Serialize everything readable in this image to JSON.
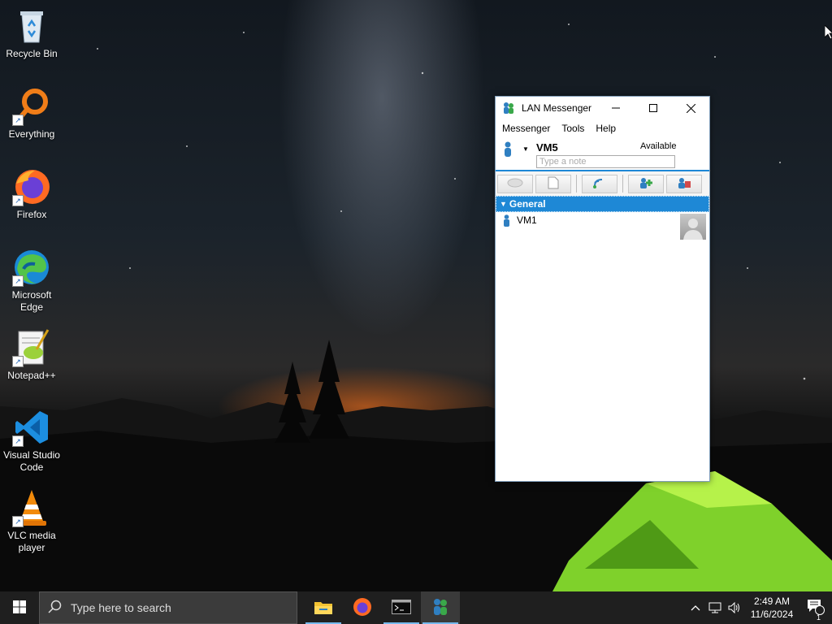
{
  "desktop": {
    "icons": [
      {
        "label": "Recycle Bin",
        "icon": "recycle-bin-icon"
      },
      {
        "label": "Everything",
        "icon": "everything-search-icon"
      },
      {
        "label": "Firefox",
        "icon": "firefox-icon"
      },
      {
        "label": "Microsoft Edge",
        "icon": "edge-icon"
      },
      {
        "label": "Notepad++",
        "icon": "notepadpp-icon"
      },
      {
        "label": "Visual Studio Code",
        "icon": "vscode-icon"
      },
      {
        "label": "VLC media player",
        "icon": "vlc-icon"
      }
    ]
  },
  "window": {
    "title": "LAN Messenger",
    "menu": [
      "Messenger",
      "Tools",
      "Help"
    ],
    "user": {
      "name": "VM5",
      "status": "Available",
      "note_placeholder": "Type a note"
    },
    "group": {
      "name": "General"
    },
    "contacts": [
      {
        "name": "VM1"
      }
    ]
  },
  "taskbar": {
    "search_placeholder": "Type here to search",
    "apps": [
      "file-explorer-icon",
      "firefox-icon",
      "terminal-icon",
      "lan-messenger-icon"
    ],
    "clock": {
      "time": "2:49 AM",
      "date": "11/6/2024"
    },
    "notification_count": "1"
  },
  "colors": {
    "accent": "#1e88d6",
    "taskbar": "#1f1f1f"
  }
}
